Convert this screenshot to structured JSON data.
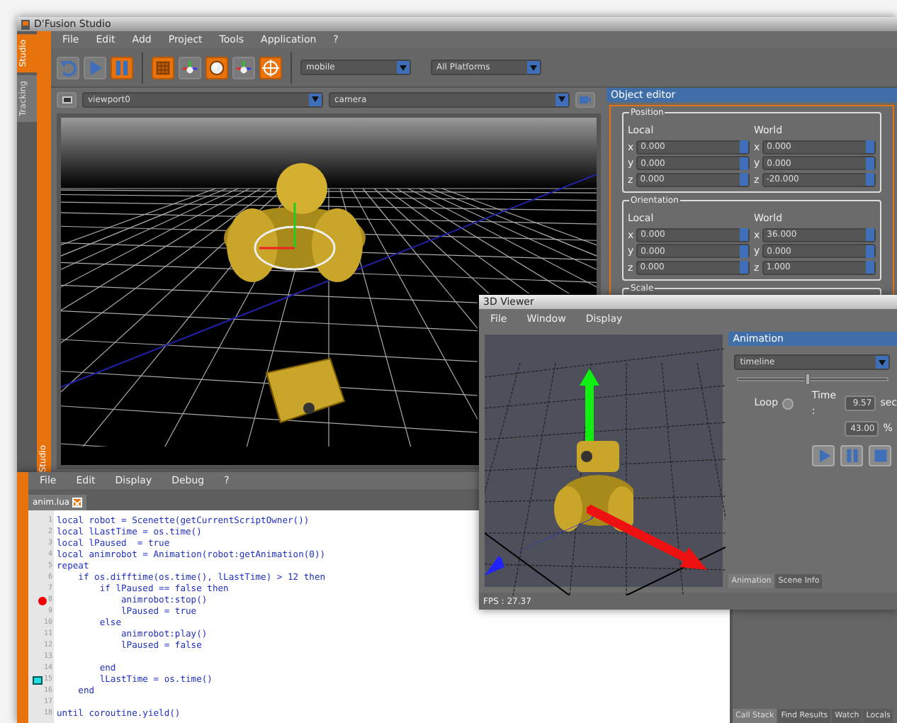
{
  "main_window": {
    "title": "D'Fusion Studio",
    "side_tabs": [
      {
        "label": "Studio",
        "selected": true
      },
      {
        "label": "Tracking",
        "selected": false
      }
    ],
    "side_strip_label": "Studio",
    "menu": [
      "File",
      "Edit",
      "Add",
      "Project",
      "Tools",
      "Application",
      "?"
    ],
    "toolbar": [
      {
        "kind": "undo",
        "active": false
      },
      {
        "kind": "play",
        "active": false
      },
      {
        "kind": "pause",
        "active": true
      },
      {
        "kind": "texture",
        "active": true
      },
      {
        "kind": "axes",
        "active": false
      },
      {
        "kind": "sphere",
        "active": true
      },
      {
        "kind": "axes",
        "active": false
      },
      {
        "kind": "target",
        "active": true
      }
    ],
    "combos": [
      "mobile",
      "All Platforms"
    ],
    "viewport_bar": {
      "viewport": "viewport0",
      "camera": "camera"
    },
    "object_editor": {
      "title": "Object editor",
      "groups": [
        {
          "legend": "Position",
          "local_label": "Local",
          "world_label": "World",
          "rows": [
            {
              "local_axis": "x",
              "local": "0.000",
              "world_axis": "x",
              "world": "0.000"
            },
            {
              "local_axis": "y",
              "local": "0.000",
              "world_axis": "y",
              "world": "0.000"
            },
            {
              "local_axis": "z",
              "local": "0.000",
              "world_axis": "z",
              "world": "-20.000"
            }
          ]
        },
        {
          "legend": "Orientation",
          "local_label": "Local",
          "world_label": "World",
          "rows": [
            {
              "local_axis": "x",
              "local": "0.000",
              "world_axis": "x",
              "world": "36.000"
            },
            {
              "local_axis": "y",
              "local": "0.000",
              "world_axis": "y",
              "world": "0.000"
            },
            {
              "local_axis": "z",
              "local": "0.000",
              "world_axis": "z",
              "world": "1.000"
            }
          ]
        }
      ],
      "cut_group_legend": "Scale"
    }
  },
  "script_editor": {
    "menu": [
      "File",
      "Edit",
      "Display",
      "Debug",
      "?"
    ],
    "tab": "anim.lua",
    "lines": [
      {
        "number": "1",
        "code": "local robot = Scenette(getCurrentScriptOwner())",
        "breakpoint": false,
        "bookmark": false
      },
      {
        "number": "2",
        "code": "local lLastTime = os.time()",
        "breakpoint": false,
        "bookmark": false
      },
      {
        "number": "3",
        "code": "local lPaused  = true",
        "breakpoint": false,
        "bookmark": false
      },
      {
        "number": "4",
        "code": "local animrobot = Animation(robot:getAnimation(0))",
        "breakpoint": false,
        "bookmark": false
      },
      {
        "number": "5",
        "code": "repeat",
        "breakpoint": false,
        "bookmark": false
      },
      {
        "number": "6",
        "code": "    if os.difftime(os.time(), lLastTime) > 12 then",
        "breakpoint": false,
        "bookmark": false
      },
      {
        "number": "7",
        "code": "        if lPaused == false then",
        "breakpoint": false,
        "bookmark": false
      },
      {
        "number": "8",
        "code": "            animrobot:stop()",
        "breakpoint": true,
        "bookmark": false
      },
      {
        "number": "9",
        "code": "            lPaused = true",
        "breakpoint": false,
        "bookmark": false
      },
      {
        "number": "10",
        "code": "        else",
        "breakpoint": false,
        "bookmark": false
      },
      {
        "number": "11",
        "code": "            animrobot:play()",
        "breakpoint": false,
        "bookmark": false
      },
      {
        "number": "12",
        "code": "            lPaused = false",
        "breakpoint": false,
        "bookmark": false
      },
      {
        "number": "13",
        "breakpoint": false,
        "bookmark": false
      },
      {
        "number": "14",
        "code": "        end",
        "breakpoint": false,
        "bookmark": false
      },
      {
        "number": "15",
        "code": "        lLastTime = os.time()",
        "breakpoint": false,
        "bookmark": true
      },
      {
        "number": "16",
        "code": "    end",
        "breakpoint": false,
        "bookmark": false
      },
      {
        "number": "17",
        "breakpoint": false,
        "bookmark": false
      },
      {
        "number": "18",
        "code": "until coroutine.yield()",
        "breakpoint": false,
        "bookmark": false
      }
    ],
    "bottom_tabs": [
      {
        "label": "Call Stack",
        "selected": true
      },
      {
        "label": "Find Results",
        "selected": false
      },
      {
        "label": "Watch",
        "selected": false
      },
      {
        "label": "Locals",
        "selected": false
      }
    ]
  },
  "viewer_window": {
    "title": "3D Viewer",
    "menu": [
      "File",
      "Window",
      "Display"
    ],
    "panel_title": "Animation",
    "timeline": "timeline",
    "slider": {
      "level": 0.45
    },
    "loop_label": "Loop",
    "loop": false,
    "time_label": "Time :",
    "time": "9.57",
    "time_unit": "sec",
    "percent": "43.00",
    "percent_unit": "%",
    "buttons": [
      {
        "kind": "play"
      },
      {
        "kind": "pause"
      },
      {
        "kind": "stop"
      }
    ],
    "tabs": [
      {
        "label": "Animation",
        "selected": true
      },
      {
        "label": "Scene Info",
        "selected": false
      }
    ],
    "status": "FPS : 27.37"
  }
}
